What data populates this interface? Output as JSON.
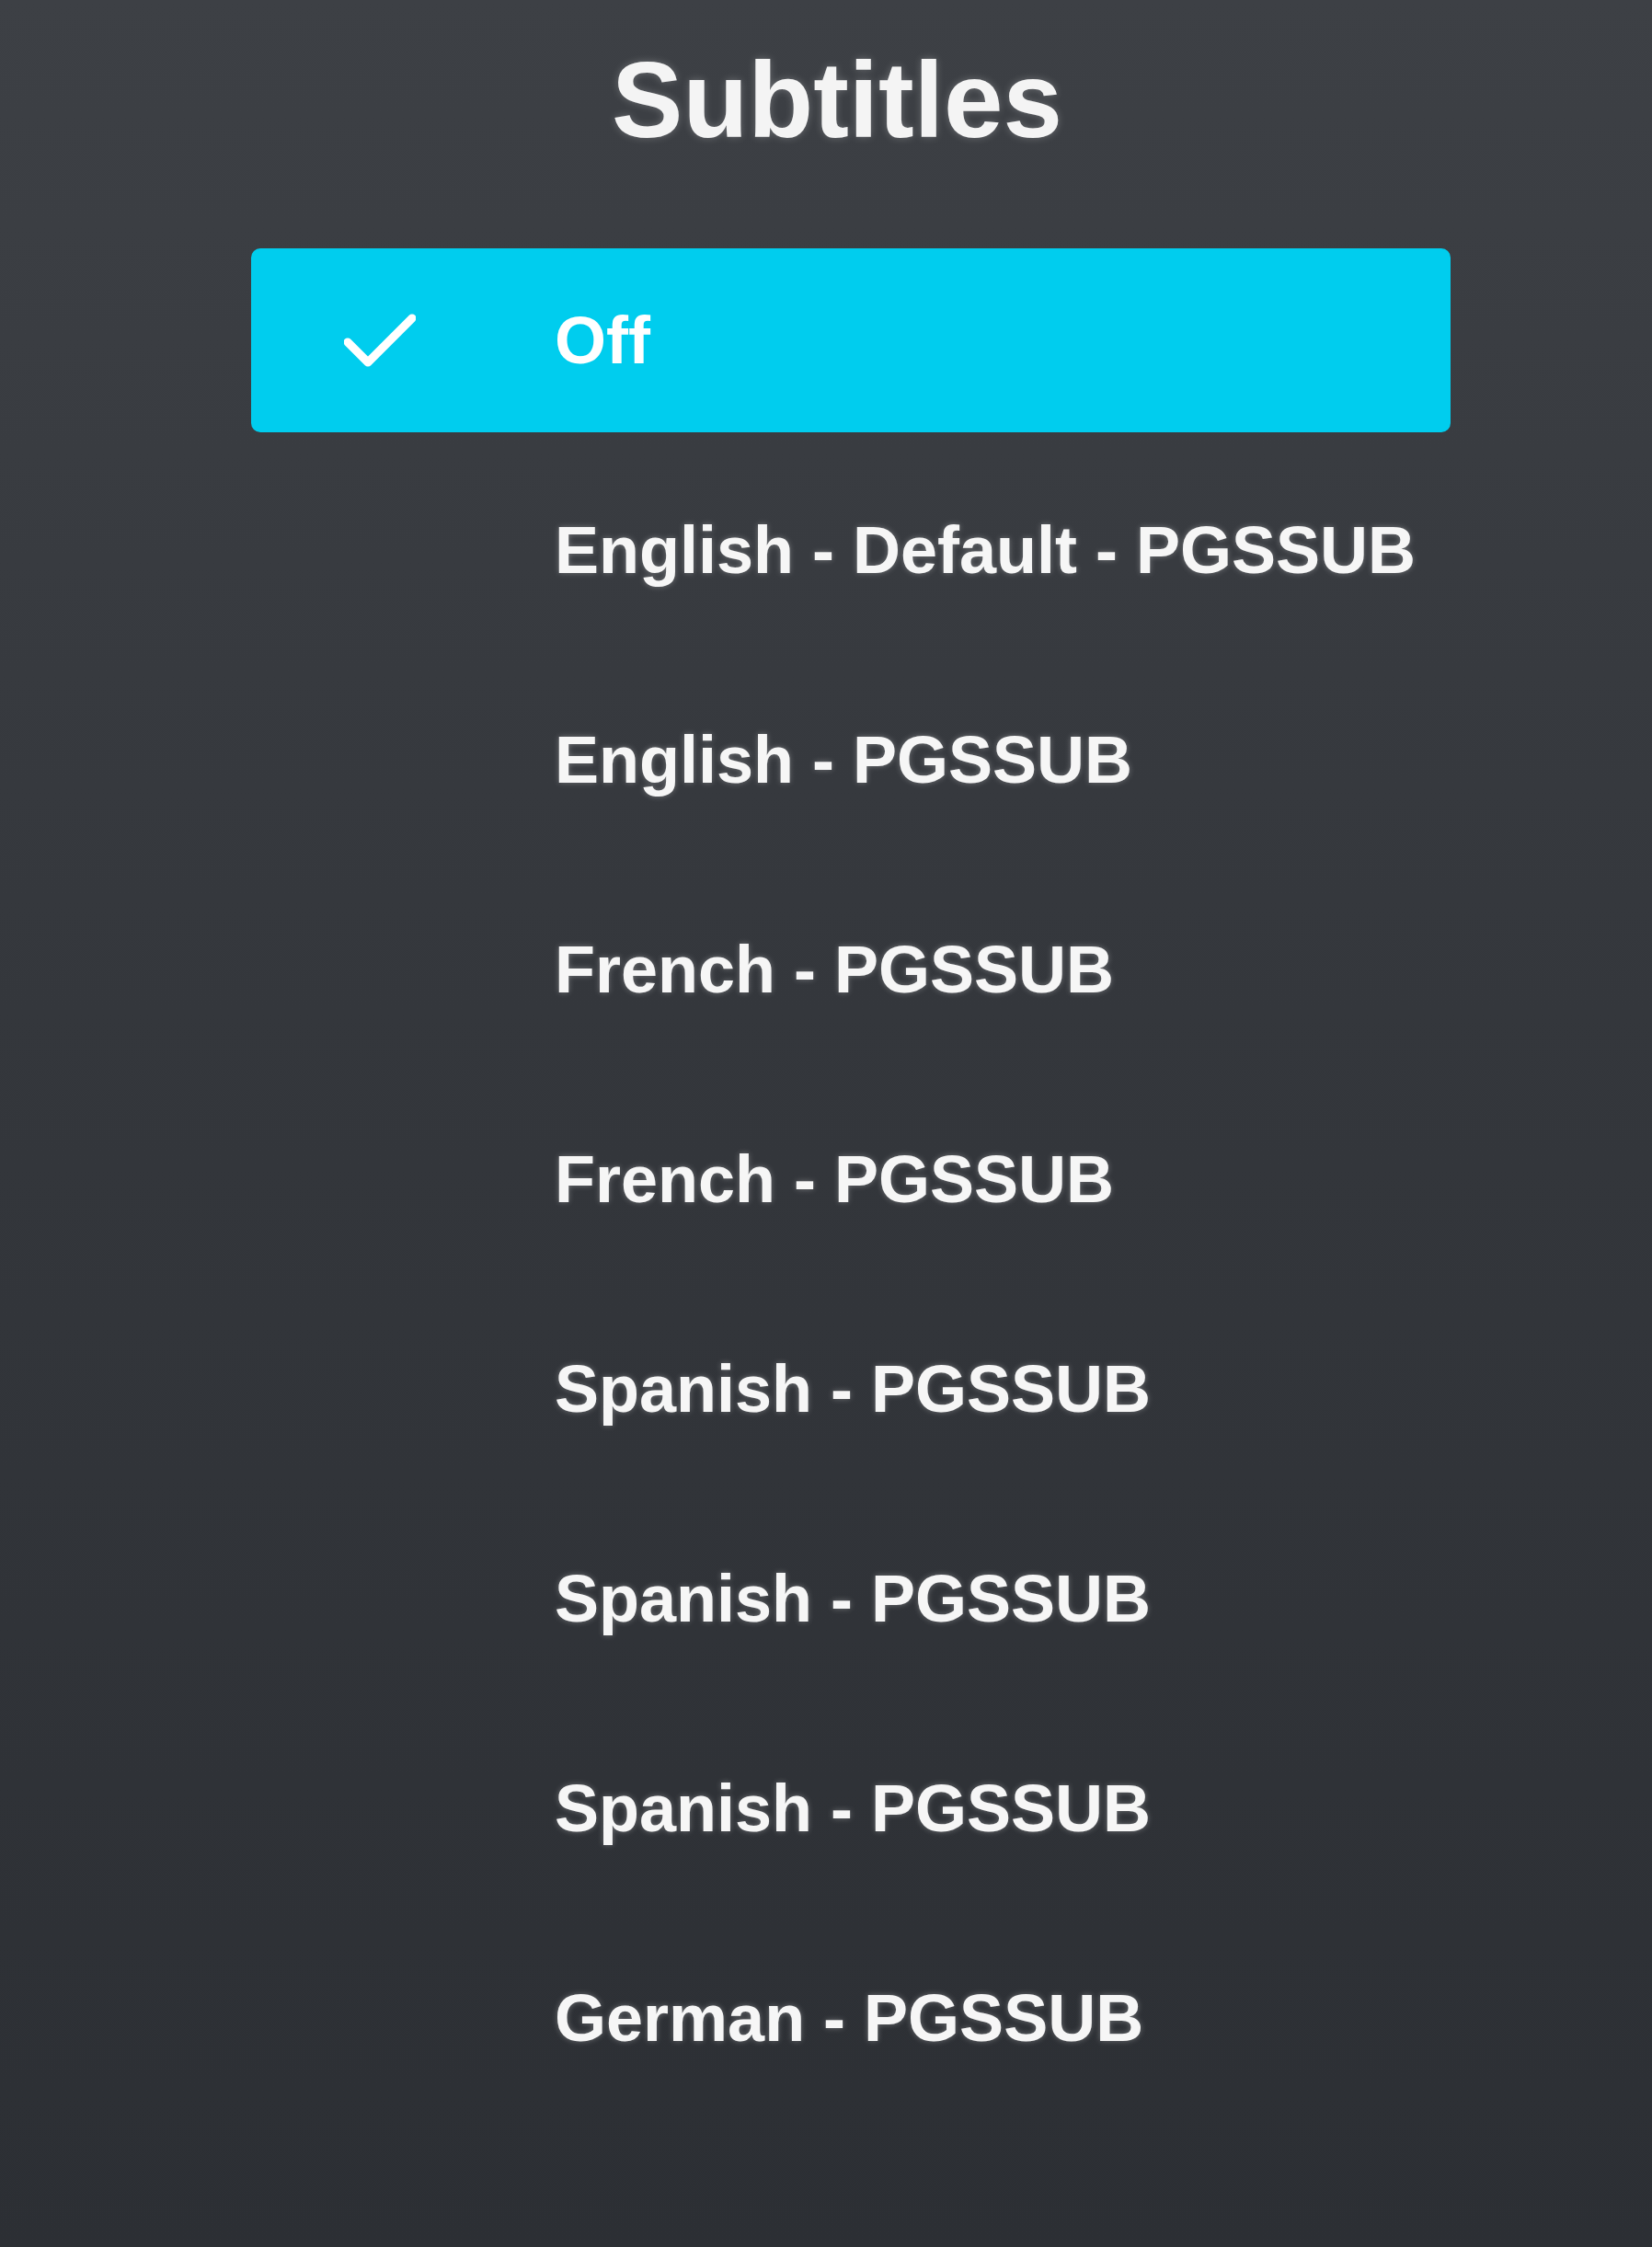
{
  "title": "Subtitles",
  "options": [
    {
      "label": "Off",
      "selected": true
    },
    {
      "label": "English - Default - PGSSUB",
      "selected": false
    },
    {
      "label": "English - PGSSUB",
      "selected": false
    },
    {
      "label": "French - PGSSUB",
      "selected": false
    },
    {
      "label": "French - PGSSUB",
      "selected": false
    },
    {
      "label": "Spanish - PGSSUB",
      "selected": false
    },
    {
      "label": "Spanish - PGSSUB",
      "selected": false
    },
    {
      "label": "Spanish - PGSSUB",
      "selected": false
    },
    {
      "label": "German - PGSSUB",
      "selected": false
    }
  ]
}
